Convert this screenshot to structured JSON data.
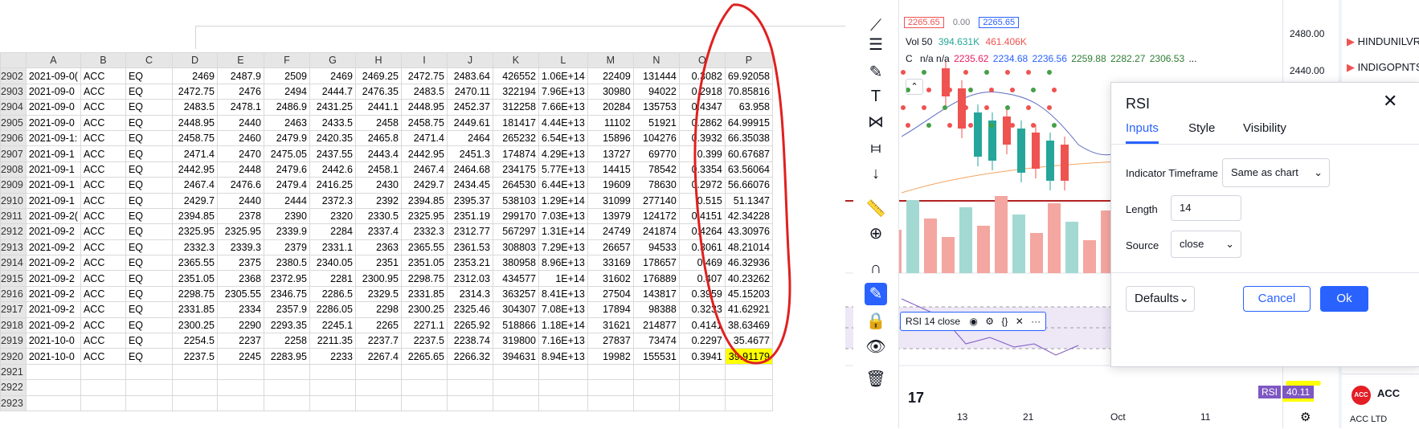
{
  "sheet": {
    "columns": [
      "A",
      "B",
      "C",
      "D",
      "E",
      "F",
      "G",
      "H",
      "I",
      "J",
      "K",
      "L",
      "M",
      "N",
      "O",
      "P"
    ],
    "rows": [
      {
        "n": "2902",
        "cells": [
          "2021-09-0(",
          "ACC",
          "EQ",
          "2469",
          "2487.9",
          "2509",
          "2469",
          "2469.25",
          "2472.75",
          "2483.64",
          "426552",
          "1.06E+14",
          "22409",
          "131444",
          "0.3082",
          "69.92058"
        ]
      },
      {
        "n": "2903",
        "cells": [
          "2021-09-0",
          "ACC",
          "EQ",
          "2472.75",
          "2476",
          "2494",
          "2444.7",
          "2476.35",
          "2483.5",
          "2470.11",
          "322194",
          "7.96E+13",
          "30980",
          "94022",
          "0.2918",
          "70.85816"
        ]
      },
      {
        "n": "2904",
        "cells": [
          "2021-09-0",
          "ACC",
          "EQ",
          "2483.5",
          "2478.1",
          "2486.9",
          "2431.25",
          "2441.1",
          "2448.95",
          "2452.37",
          "312258",
          "7.66E+13",
          "20284",
          "135753",
          "0.4347",
          "63.958"
        ]
      },
      {
        "n": "2905",
        "cells": [
          "2021-09-0",
          "ACC",
          "EQ",
          "2448.95",
          "2440",
          "2463",
          "2433.5",
          "2458",
          "2458.75",
          "2449.61",
          "181417",
          "4.44E+13",
          "11102",
          "51921",
          "0.2862",
          "64.99915"
        ]
      },
      {
        "n": "2906",
        "cells": [
          "2021-09-1:",
          "ACC",
          "EQ",
          "2458.75",
          "2460",
          "2479.9",
          "2420.35",
          "2465.8",
          "2471.4",
          "2464",
          "265232",
          "6.54E+13",
          "15896",
          "104276",
          "0.3932",
          "66.35038"
        ]
      },
      {
        "n": "2907",
        "cells": [
          "2021-09-1",
          "ACC",
          "EQ",
          "2471.4",
          "2470",
          "2475.05",
          "2437.55",
          "2443.4",
          "2442.95",
          "2451.3",
          "174874",
          "4.29E+13",
          "13727",
          "69770",
          "0.399",
          "60.67687"
        ]
      },
      {
        "n": "2908",
        "cells": [
          "2021-09-1",
          "ACC",
          "EQ",
          "2442.95",
          "2448",
          "2479.6",
          "2442.6",
          "2458.1",
          "2467.4",
          "2464.68",
          "234175",
          "5.77E+13",
          "14415",
          "78542",
          "0.3354",
          "63.56064"
        ]
      },
      {
        "n": "2909",
        "cells": [
          "2021-09-1",
          "ACC",
          "EQ",
          "2467.4",
          "2476.6",
          "2479.4",
          "2416.25",
          "2430",
          "2429.7",
          "2434.45",
          "264530",
          "6.44E+13",
          "19609",
          "78630",
          "0.2972",
          "56.66076"
        ]
      },
      {
        "n": "2910",
        "cells": [
          "2021-09-1",
          "ACC",
          "EQ",
          "2429.7",
          "2440",
          "2444",
          "2372.3",
          "2392",
          "2394.85",
          "2395.37",
          "538103",
          "1.29E+14",
          "31099",
          "277140",
          "0.515",
          "51.1347"
        ]
      },
      {
        "n": "2911",
        "cells": [
          "2021-09-2(",
          "ACC",
          "EQ",
          "2394.85",
          "2378",
          "2390",
          "2320",
          "2330.5",
          "2325.95",
          "2351.19",
          "299170",
          "7.03E+13",
          "13979",
          "124172",
          "0.4151",
          "42.34228"
        ]
      },
      {
        "n": "2912",
        "cells": [
          "2021-09-2",
          "ACC",
          "EQ",
          "2325.95",
          "2325.95",
          "2339.9",
          "2284",
          "2337.4",
          "2332.3",
          "2312.77",
          "567297",
          "1.31E+14",
          "24749",
          "241874",
          "0.4264",
          "43.30976"
        ]
      },
      {
        "n": "2913",
        "cells": [
          "2021-09-2",
          "ACC",
          "EQ",
          "2332.3",
          "2339.3",
          "2379",
          "2331.1",
          "2363",
          "2365.55",
          "2361.53",
          "308803",
          "7.29E+13",
          "26657",
          "94533",
          "0.3061",
          "48.21014"
        ]
      },
      {
        "n": "2914",
        "cells": [
          "2021-09-2",
          "ACC",
          "EQ",
          "2365.55",
          "2375",
          "2380.5",
          "2340.05",
          "2351",
          "2351.05",
          "2353.21",
          "380958",
          "8.96E+13",
          "33169",
          "178657",
          "0.469",
          "46.32936"
        ]
      },
      {
        "n": "2915",
        "cells": [
          "2021-09-2",
          "ACC",
          "EQ",
          "2351.05",
          "2368",
          "2372.95",
          "2281",
          "2300.95",
          "2298.75",
          "2312.03",
          "434577",
          "1E+14",
          "31602",
          "176889",
          "0.407",
          "40.23262"
        ]
      },
      {
        "n": "2916",
        "cells": [
          "2021-09-2",
          "ACC",
          "EQ",
          "2298.75",
          "2305.55",
          "2346.75",
          "2286.5",
          "2329.5",
          "2331.85",
          "2314.3",
          "363257",
          "8.41E+13",
          "27504",
          "143817",
          "0.3959",
          "45.15203"
        ]
      },
      {
        "n": "2917",
        "cells": [
          "2021-09-2",
          "ACC",
          "EQ",
          "2331.85",
          "2334",
          "2357.9",
          "2286.05",
          "2298",
          "2300.25",
          "2325.46",
          "304307",
          "7.08E+13",
          "17894",
          "98388",
          "0.3233",
          "41.62921"
        ]
      },
      {
        "n": "2918",
        "cells": [
          "2021-09-2",
          "ACC",
          "EQ",
          "2300.25",
          "2290",
          "2293.35",
          "2245.1",
          "2265",
          "2271.1",
          "2265.92",
          "518866",
          "1.18E+14",
          "31621",
          "214877",
          "0.4141",
          "38.63469"
        ]
      },
      {
        "n": "2919",
        "cells": [
          "2021-10-0",
          "ACC",
          "EQ",
          "2254.5",
          "2237",
          "2258",
          "2211.35",
          "2237.7",
          "2237.5",
          "2238.74",
          "319800",
          "7.16E+13",
          "27837",
          "73474",
          "0.2297",
          "35.4677"
        ]
      },
      {
        "n": "2920",
        "cells": [
          "2021-10-0",
          "ACC",
          "EQ",
          "2237.5",
          "2245",
          "2283.95",
          "2233",
          "2267.4",
          "2265.65",
          "2266.32",
          "394631",
          "8.94E+13",
          "19982",
          "155531",
          "0.3941",
          "39.91179"
        ]
      },
      {
        "n": "2921",
        "cells": [
          "",
          "",
          "",
          "",
          "",
          "",
          "",
          "",
          "",
          "",
          "",
          "",
          "",
          "",
          "",
          ""
        ]
      },
      {
        "n": "2922",
        "cells": [
          "",
          "",
          "",
          "",
          "",
          "",
          "",
          "",
          "",
          "",
          "",
          "",
          "",
          "",
          "",
          ""
        ]
      },
      {
        "n": "2923",
        "cells": [
          "",
          "",
          "",
          "",
          "",
          "",
          "",
          "",
          "",
          "",
          "",
          "",
          "",
          "",
          "",
          ""
        ]
      }
    ]
  },
  "chart": {
    "price_box_1": "2265.65",
    "price_box_2": "0.00",
    "price_box_3": "2265.65",
    "vol_label": "Vol 50",
    "vol_v1": "394.631K",
    "vol_v2": "461.406K",
    "c_label": "C",
    "c_na": "n/a n/a",
    "c_vals": [
      "2235.62",
      "2234.68",
      "2236.56",
      "2259.88",
      "2282.27",
      "2306.53"
    ],
    "c_more": "...",
    "price_scale": [
      "2480.00",
      "2440.00"
    ],
    "rsi_legend": "RSI 14 close",
    "rsi_tag": "RSI",
    "rsi_value": "40.11",
    "x_ticks": [
      "13",
      "21",
      "Oct",
      "11"
    ],
    "watchlist": [
      "HINDUNILVR",
      "INDIGOPNTS"
    ],
    "symbol_title": "ACC",
    "symbol_sub": "ACC LTD",
    "colors": {
      "up": "#26a69a",
      "down": "#ef5350",
      "accent": "#2962ff",
      "rsi": "#7e57c2"
    }
  },
  "modal": {
    "title": "RSI",
    "tabs": [
      "Inputs",
      "Style",
      "Visibility"
    ],
    "timeframe_label": "Indicator Timeframe",
    "timeframe_value": "Same as chart",
    "length_label": "Length",
    "length_value": "14",
    "source_label": "Source",
    "source_value": "close",
    "defaults_label": "Defaults",
    "cancel_label": "Cancel",
    "ok_label": "Ok"
  }
}
